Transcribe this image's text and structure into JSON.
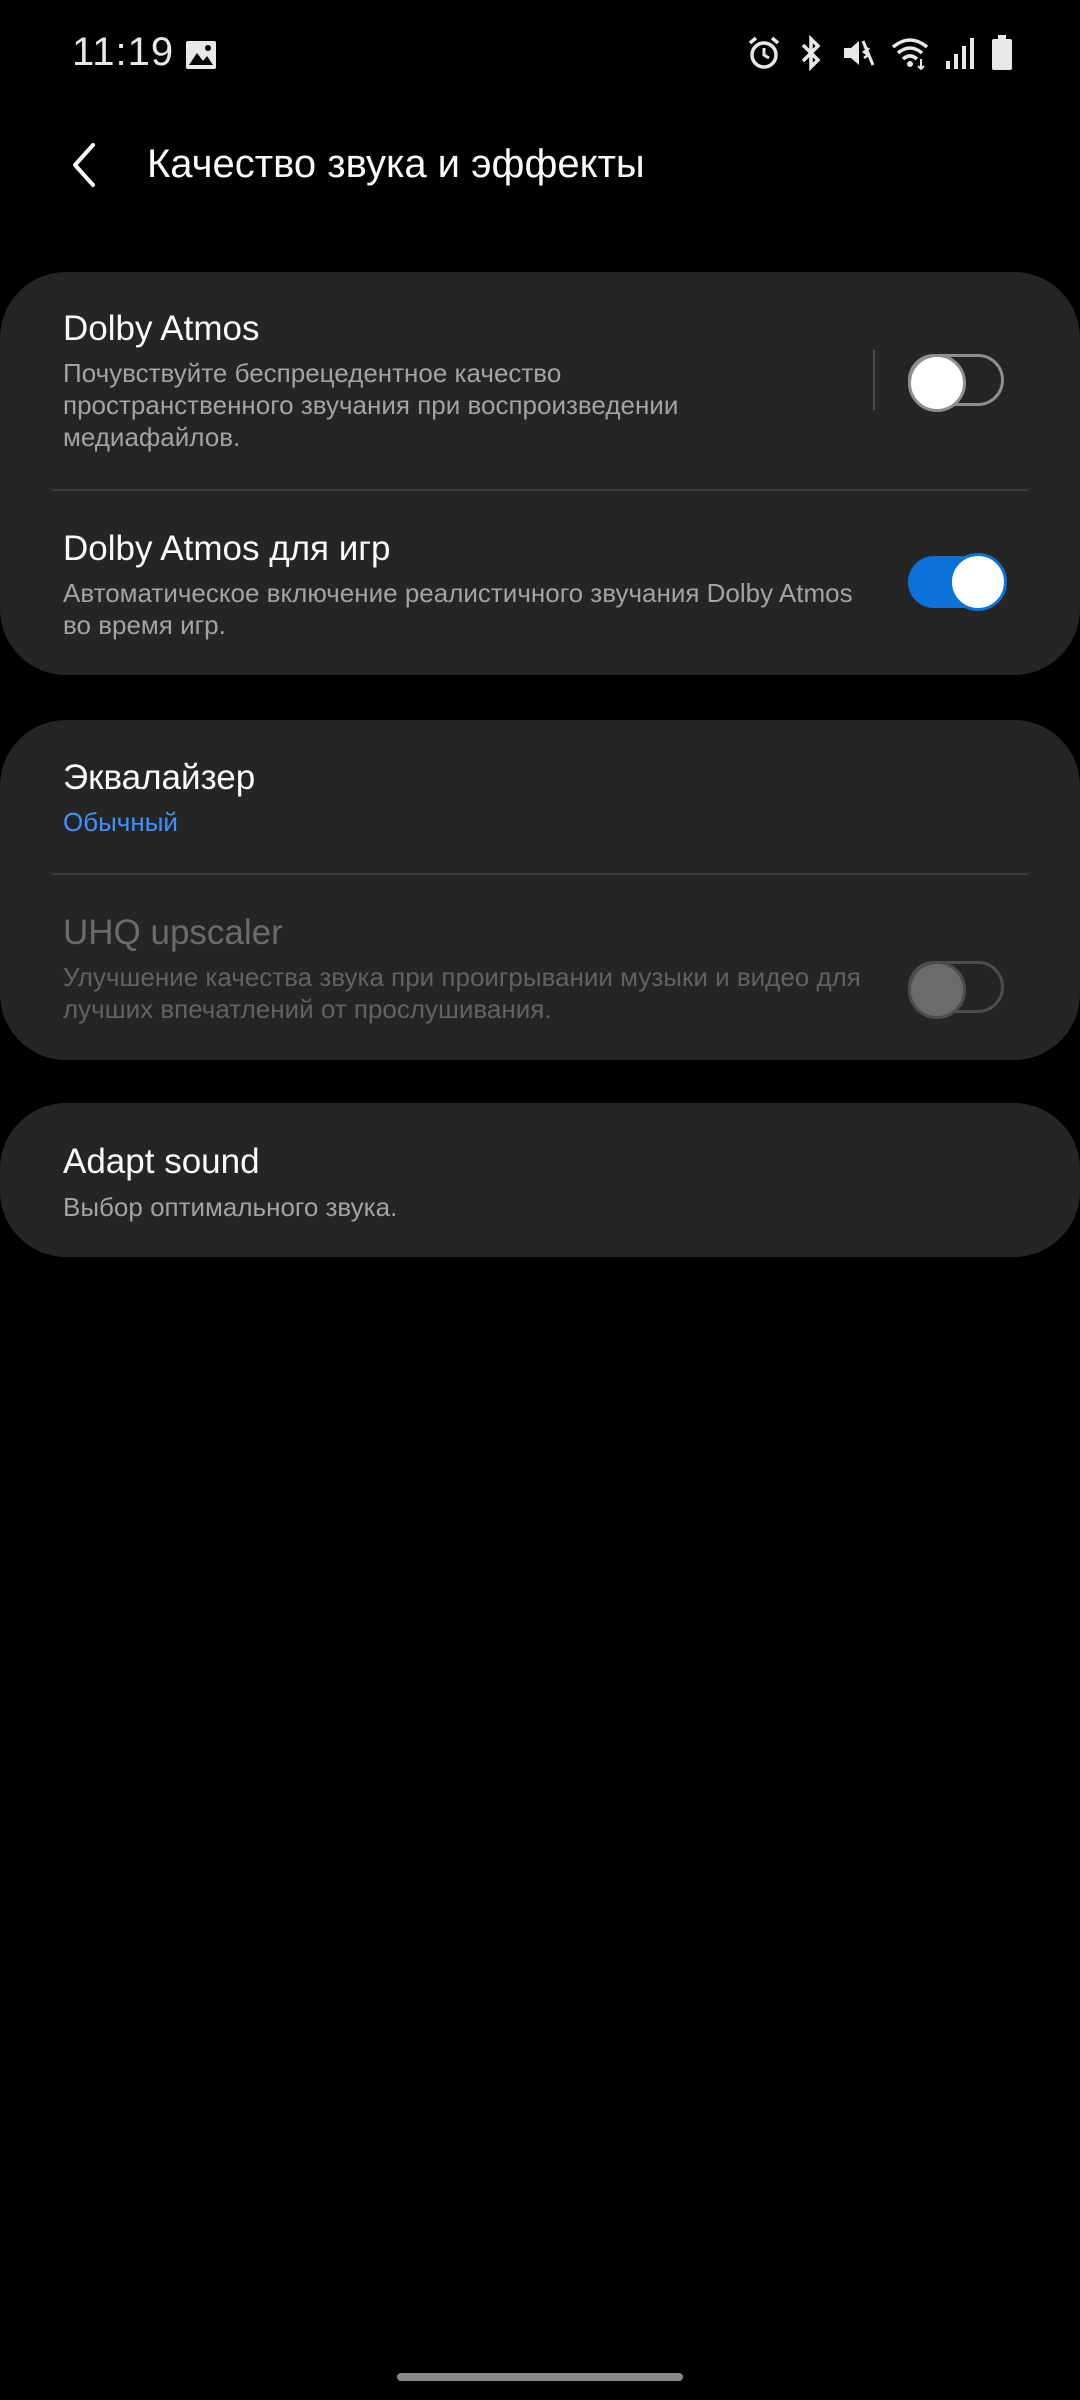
{
  "status_bar": {
    "time": "11:19",
    "icons": [
      "gallery-icon",
      "alarm-icon",
      "bluetooth-icon",
      "mute-vibrate-icon",
      "wifi-icon",
      "signal-icon",
      "battery-icon"
    ]
  },
  "app_bar": {
    "back_icon": "chevron-left-icon",
    "title": "Качество звука и эффекты"
  },
  "sections": {
    "dolby": {
      "atmos": {
        "title": "Dolby Atmos",
        "subtitle": "Почувствуйте беспрецедентное качество пространственного звучания при воспроизведении медиафайлов.",
        "enabled": false
      },
      "atmos_games": {
        "title": "Dolby Atmos для игр",
        "subtitle": "Автоматическое включение реалистичного звучания Dolby Atmos во время игр.",
        "enabled": true
      }
    },
    "sound": {
      "equalizer": {
        "title": "Эквалайзер",
        "value": "Обычный"
      },
      "uhq": {
        "title": "UHQ upscaler",
        "subtitle": "Улучшение качества звука при проигрывании музыки и видео для лучших впечатлений от прослушивания.",
        "enabled": false,
        "available": false
      }
    },
    "adapt": {
      "title": "Adapt sound",
      "subtitle": "Выбор оптимального звука."
    }
  },
  "colors": {
    "background": "#000000",
    "card": "#252525",
    "accent": "#0b72d9",
    "value_text": "#3e91ff"
  }
}
